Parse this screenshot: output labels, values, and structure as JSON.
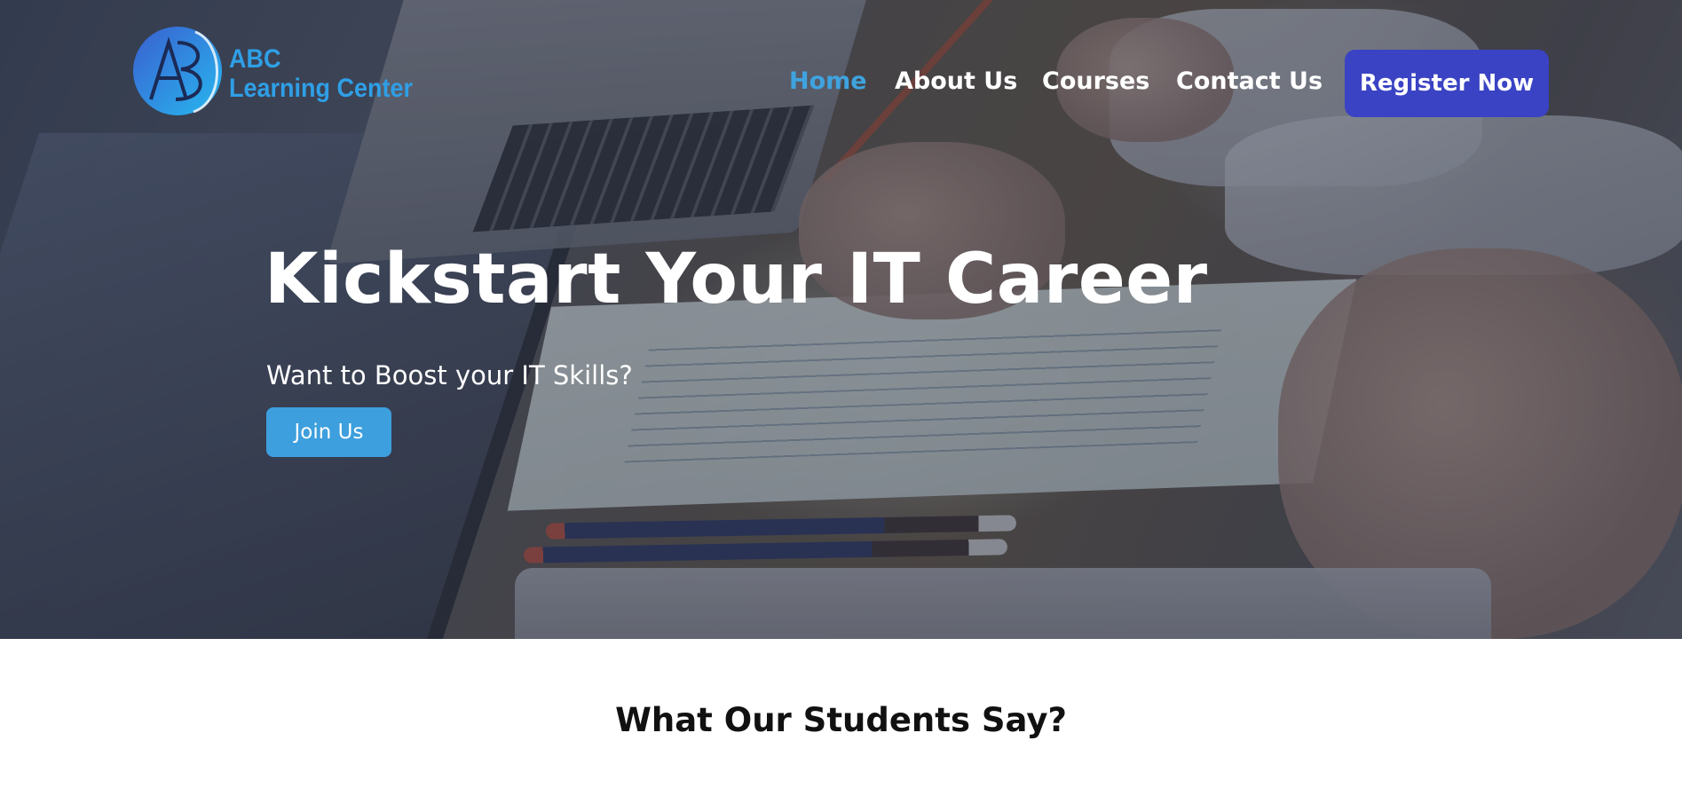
{
  "logo": {
    "line1": "ABC",
    "line2": "Learning Center",
    "icon": "abc-monogram-logo"
  },
  "nav": {
    "items": [
      {
        "label": "Home",
        "active": true
      },
      {
        "label": "About Us",
        "active": false
      },
      {
        "label": "Courses",
        "active": false
      },
      {
        "label": "Contact Us",
        "active": false
      }
    ],
    "register_label": "Register Now"
  },
  "hero": {
    "title": "Kickstart Your IT Career",
    "subtitle": "Want to Boost your IT Skills?",
    "cta_label": "Join Us",
    "background": "photo-laptops-and-notes"
  },
  "testimonials": {
    "title": "What Our Students Say?"
  },
  "colors": {
    "brand_blue": "#2f9fe6",
    "nav_active": "#3fa3df",
    "register_bg": "#3a43c3",
    "join_bg": "#3d9fdd"
  }
}
